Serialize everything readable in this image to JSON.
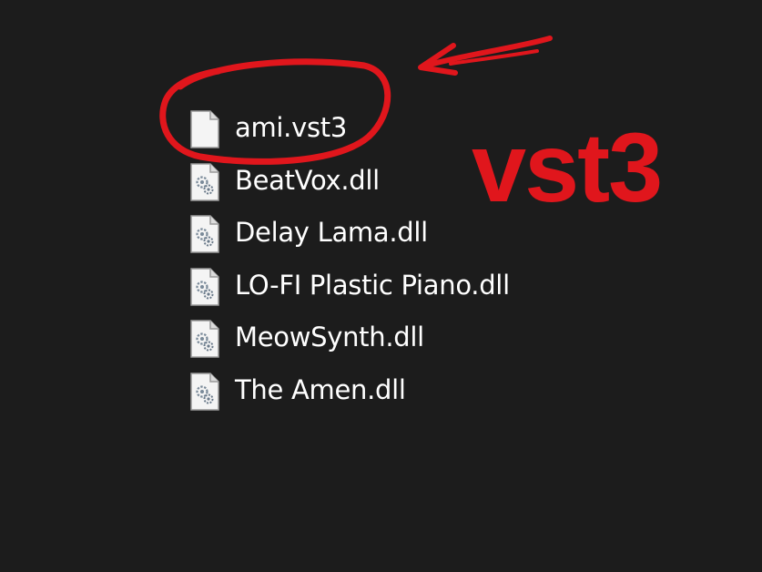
{
  "files": [
    {
      "name": "ami.vst3",
      "icon": "blank-file-icon"
    },
    {
      "name": "BeatVox.dll",
      "icon": "dll-file-icon"
    },
    {
      "name": "Delay Lama.dll",
      "icon": "dll-file-icon"
    },
    {
      "name": "LO-FI Plastic Piano.dll",
      "icon": "dll-file-icon"
    },
    {
      "name": "MeowSynth.dll",
      "icon": "dll-file-icon"
    },
    {
      "name": "The Amen.dll",
      "icon": "dll-file-icon"
    }
  ],
  "annotation": {
    "label": "vst3",
    "color": "#e0161c"
  },
  "colors": {
    "background": "#1c1c1c",
    "text": "#ffffff"
  }
}
